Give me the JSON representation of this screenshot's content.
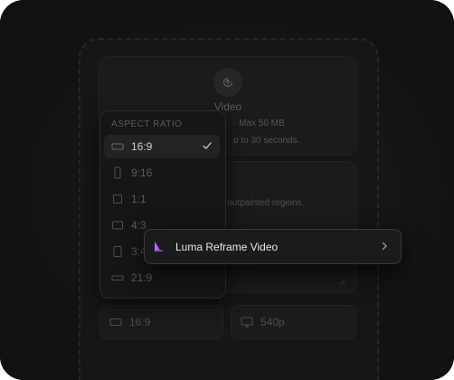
{
  "upload": {
    "title": "Video",
    "limit_text": "· Max 50 MB",
    "duration_text": "p to 30 seconds."
  },
  "prompt": {
    "hint": "o outpainted regions."
  },
  "aspect_ratio": {
    "header": "ASPECT RATIO",
    "options": [
      {
        "label": "16:9",
        "shape": "wide"
      },
      {
        "label": "9:16",
        "shape": "tall"
      },
      {
        "label": "1:1",
        "shape": "square"
      },
      {
        "label": "4:3",
        "shape": "landscape"
      },
      {
        "label": "3:4",
        "shape": "portrait"
      },
      {
        "label": "21:9",
        "shape": "ultrawide"
      }
    ],
    "selected": "16:9"
  },
  "toolbar": {
    "aspect_value": "16:9",
    "resolution_value": "540p"
  },
  "popover": {
    "model_label": "Luma Reframe Video",
    "brand_color": "#8b3fd6"
  },
  "colors": {
    "background": "#121212",
    "panel": "#1b1b1b",
    "accent_purple": "#8b3fd6"
  }
}
